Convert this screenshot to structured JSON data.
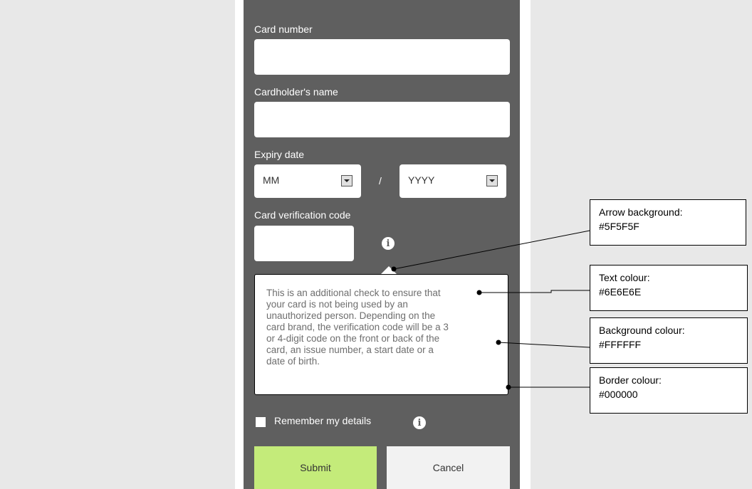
{
  "form": {
    "card_number_label": "Card number",
    "cardholder_label": "Cardholder's name",
    "expiry_label": "Expiry date",
    "expiry_month": "MM",
    "expiry_separator": "/",
    "expiry_year": "YYYY",
    "cvc_label": "Card verification code",
    "tooltip_lines": [
      "This is an additional check to ensure that",
      "your card is not being used by an",
      "unauthorized person. Depending on the",
      "card brand, the verification code will be a 3",
      "or 4-digit code on the front or back of the",
      "card, an issue number, a start date or a",
      "date of birth."
    ],
    "remember_label": "Remember my details",
    "submit_label": "Submit",
    "cancel_label": "Cancel"
  },
  "annotations": [
    {
      "line1": "Arrow background:",
      "line2": "#5F5F5F"
    },
    {
      "line1": "Text colour:",
      "line2": "#6E6E6E"
    },
    {
      "line1": "Background colour:",
      "line2": "#FFFFFF"
    },
    {
      "line1": "Border colour:",
      "line2": "#000000"
    }
  ],
  "colors": {
    "panel": "#5f5f5f",
    "submit": "#c4eb7a",
    "cancel": "#f2f2f2",
    "tooltip_text": "#6e6e6e"
  },
  "icons": [
    "info-icon",
    "checkbox-icon",
    "dropdown-arrow-icon"
  ]
}
